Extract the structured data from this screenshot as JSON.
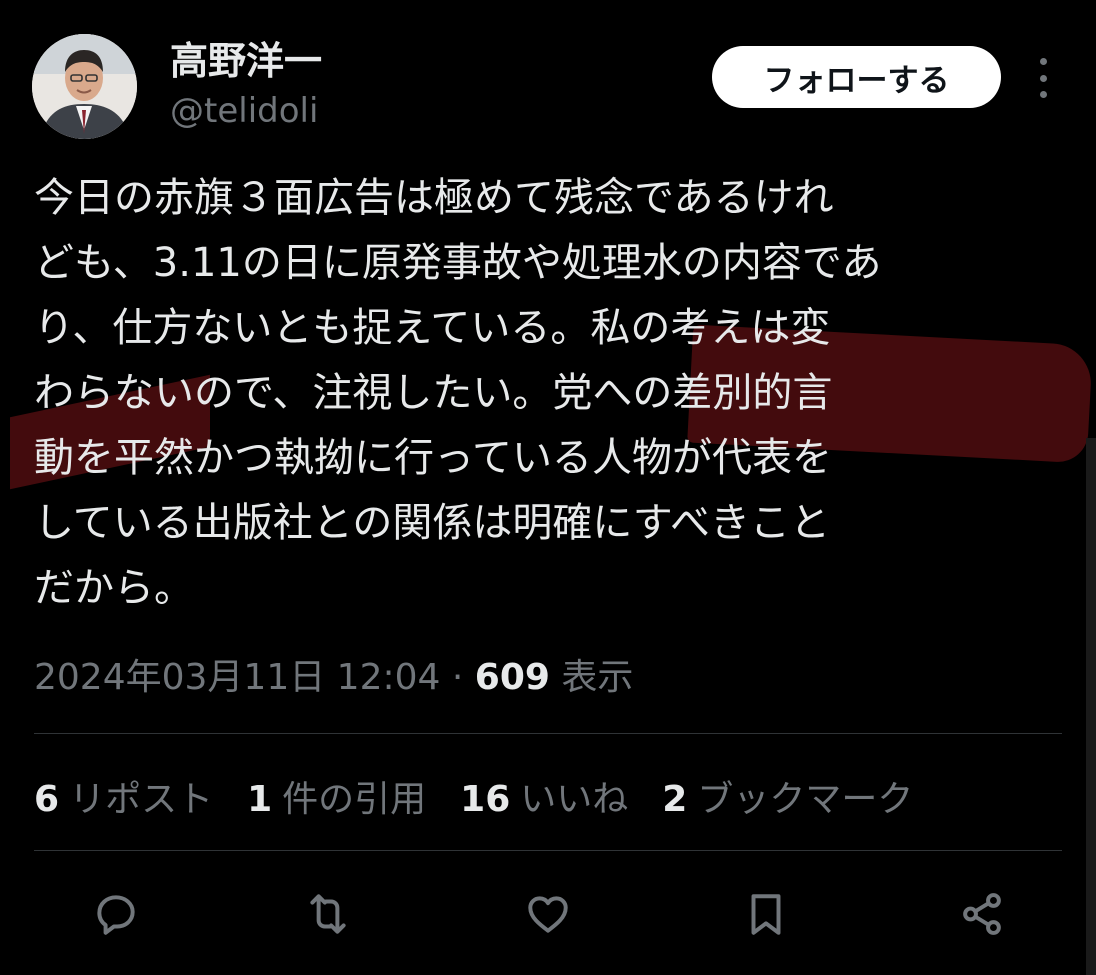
{
  "author": {
    "display_name": "高野洋一",
    "handle": "@telidoli"
  },
  "header": {
    "follow_label": "フォローする"
  },
  "tweet": {
    "lines": [
      "今日の赤旗３面広告は極めて残念であるけれ",
      "ども、3.11の日に原発事故や処理水の内容であ",
      "り、仕方ないとも捉えている。私の考えは変",
      "わらないので、注視したい。党への差別的言",
      "動を平然かつ執拗に行っている人物が代表を",
      "している出版社との関係は明確にすべきこと",
      "だから。"
    ]
  },
  "meta": {
    "timestamp": "2024年03月11日 12:04",
    "separator": "·",
    "views_count": "609",
    "views_label": "表示"
  },
  "stats": [
    {
      "count": "6",
      "label": "リポスト"
    },
    {
      "count": "1",
      "label": "件の引用"
    },
    {
      "count": "16",
      "label": "いいね"
    },
    {
      "count": "2",
      "label": "ブックマーク"
    }
  ],
  "actions": [
    "reply-icon",
    "repost-icon",
    "like-icon",
    "bookmark-icon",
    "share-icon"
  ],
  "colors": {
    "background": "#000000",
    "text_primary": "#e7e9ea",
    "text_secondary": "#71767b",
    "divider": "#2f3336",
    "highlight_mark": "#7a1417"
  }
}
